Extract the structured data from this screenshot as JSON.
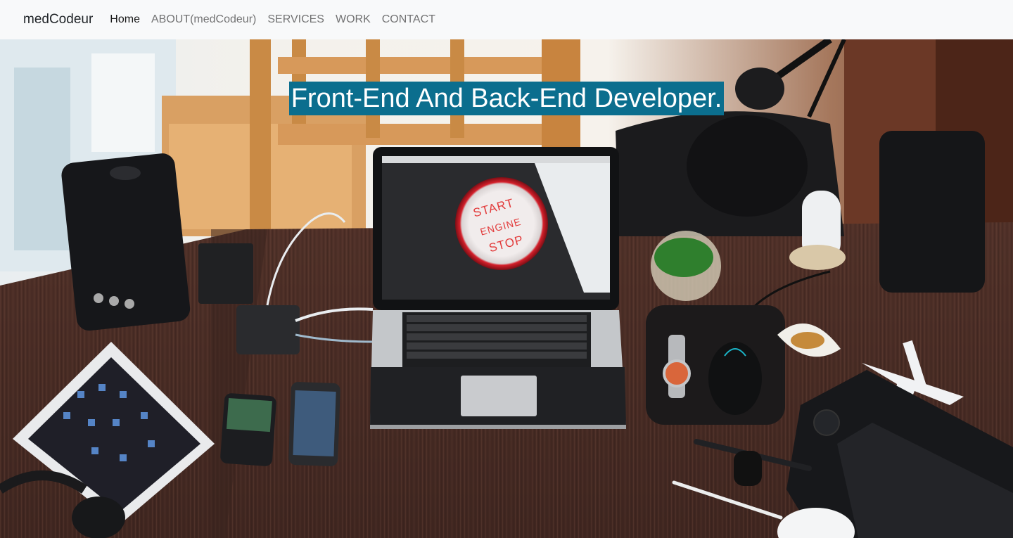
{
  "navbar": {
    "brand": "medCodeur",
    "links": [
      {
        "label": "Home",
        "active": true
      },
      {
        "label": "ABOUT(medCodeur)",
        "active": false
      },
      {
        "label": "SERVICES",
        "active": false
      },
      {
        "label": "WORK",
        "active": false
      },
      {
        "label": "CONTACT",
        "active": false
      }
    ]
  },
  "hero": {
    "headline": "Front-End And Back-End Developer.",
    "button_text_lines": [
      "START",
      "ENGINE",
      "STOP"
    ]
  },
  "colors": {
    "navbar_bg": "#f8f9fa",
    "headline_bg": "#0b6e8e",
    "desk": "#4a2d26"
  }
}
